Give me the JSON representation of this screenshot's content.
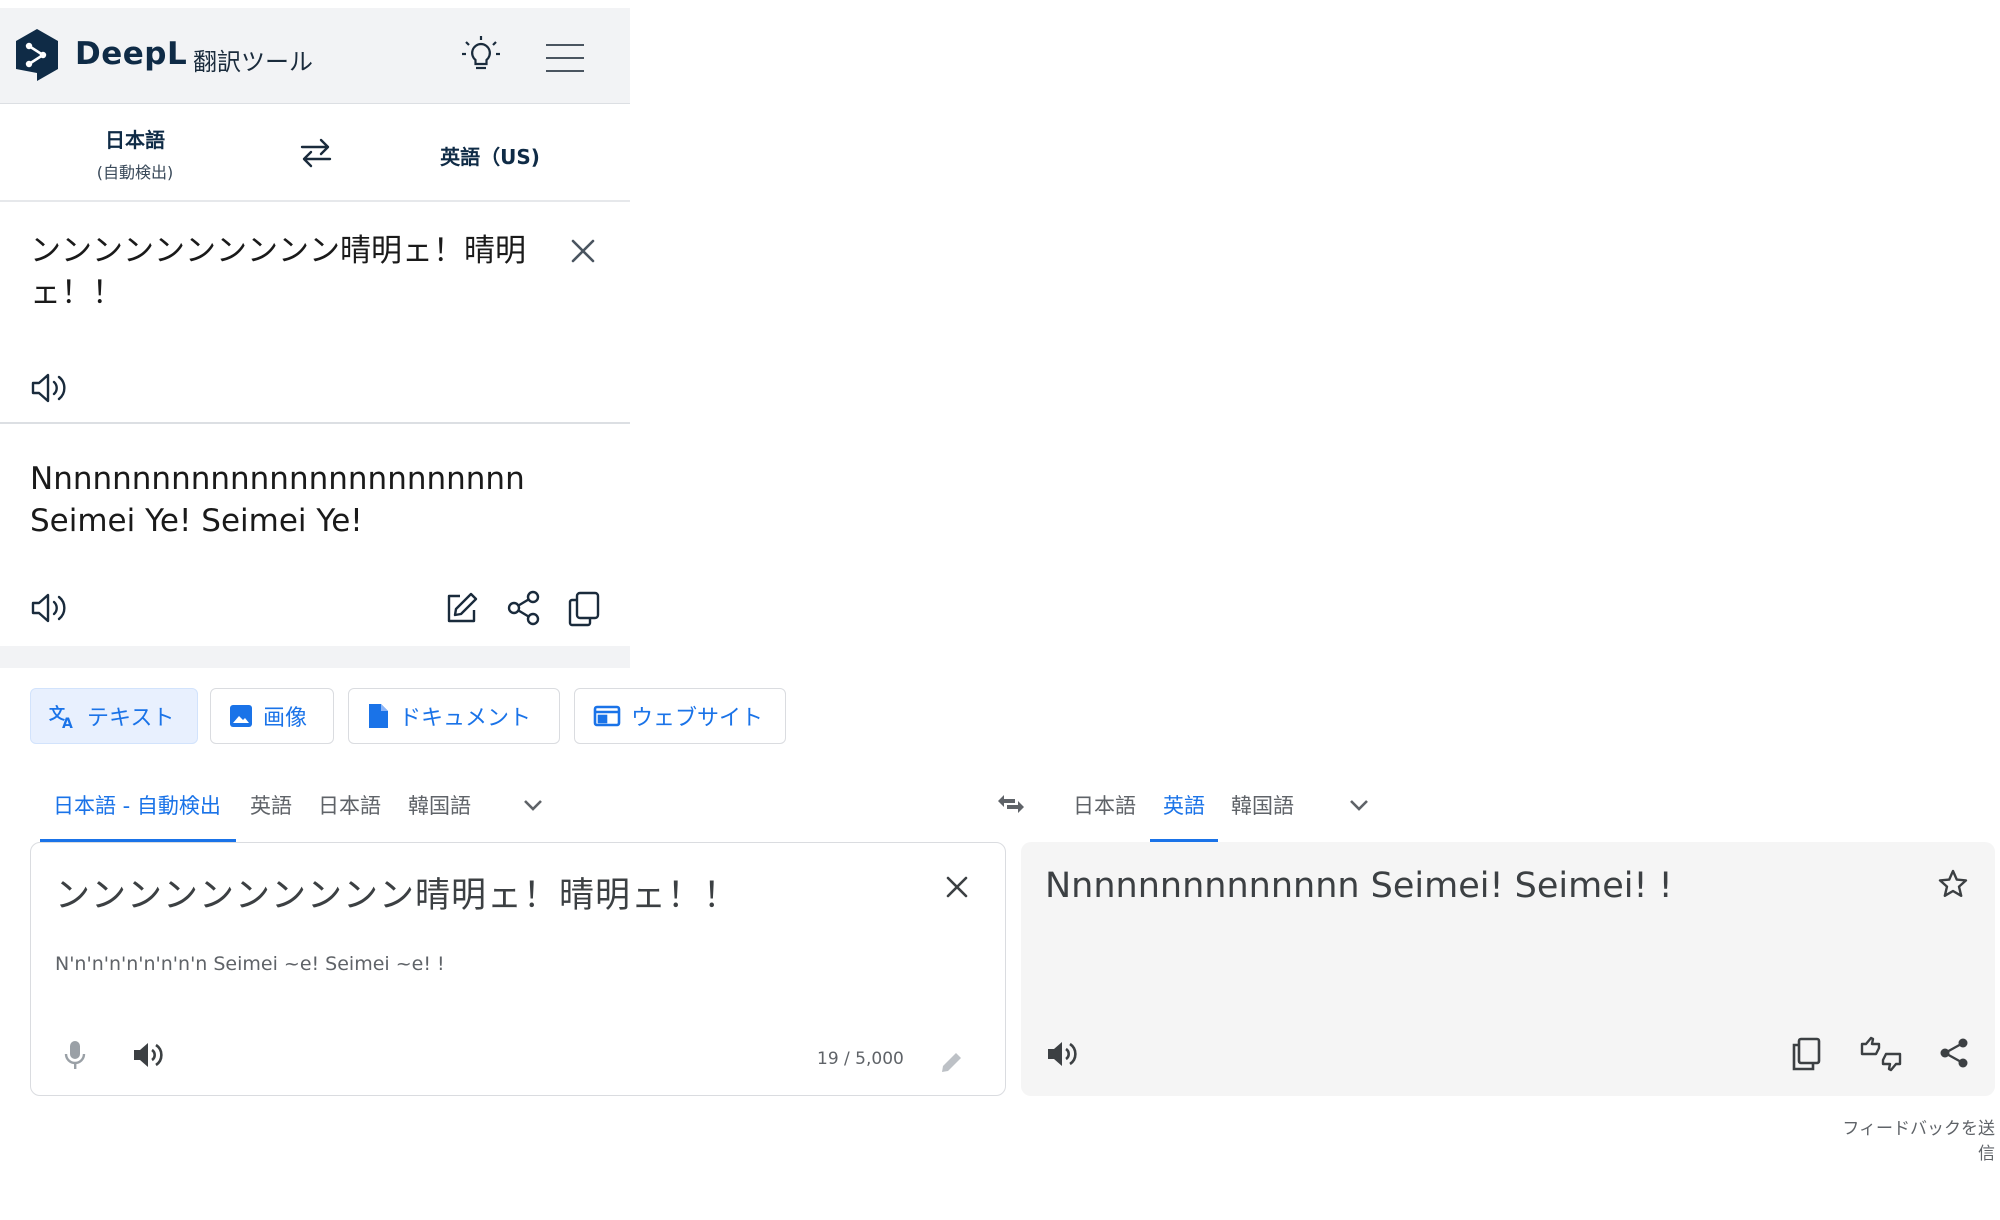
{
  "deepl": {
    "brand": "DeepL",
    "brand_subtitle": "翻訳ツール",
    "source_lang": "日本語",
    "source_lang_note": "(自動検出)",
    "target_lang": "英語（US)",
    "source_text": "ンンンンンンンンンン晴明ェ！晴明ェ！！",
    "translation": "Nnnnnnnnnnnnnnnnnnnnnnnnn Seimei Ye! Seimei Ye!",
    "brand_color": "#0f2b46"
  },
  "gtranslate": {
    "modes": [
      {
        "label": "テキスト",
        "icon": "translate-icon",
        "active": true
      },
      {
        "label": "画像",
        "icon": "image-icon",
        "active": false
      },
      {
        "label": "ドキュメント",
        "icon": "document-icon",
        "active": false
      },
      {
        "label": "ウェブサイト",
        "icon": "website-icon",
        "active": false
      }
    ],
    "source_tabs": [
      "日本語 - 自動検出",
      "英語",
      "日本語",
      "韓国語"
    ],
    "target_tabs": [
      "日本語",
      "英語",
      "韓国語"
    ],
    "active_source_tab": "日本語 - 自動検出",
    "active_target_tab": "英語",
    "source_text": "ンンンンンンンンンン晴明ェ！晴明ェ！！",
    "transliteration": "N'n'n'n'n'n'n'n'n Seimei ~e! Seimei ~e! !",
    "char_count": "19 / 5,000",
    "translation": "Nnnnnnnnnnnnnn Seimei! Seimei! !",
    "feedback_link": "フィードバックを送信",
    "accent_color": "#1a73e8"
  }
}
